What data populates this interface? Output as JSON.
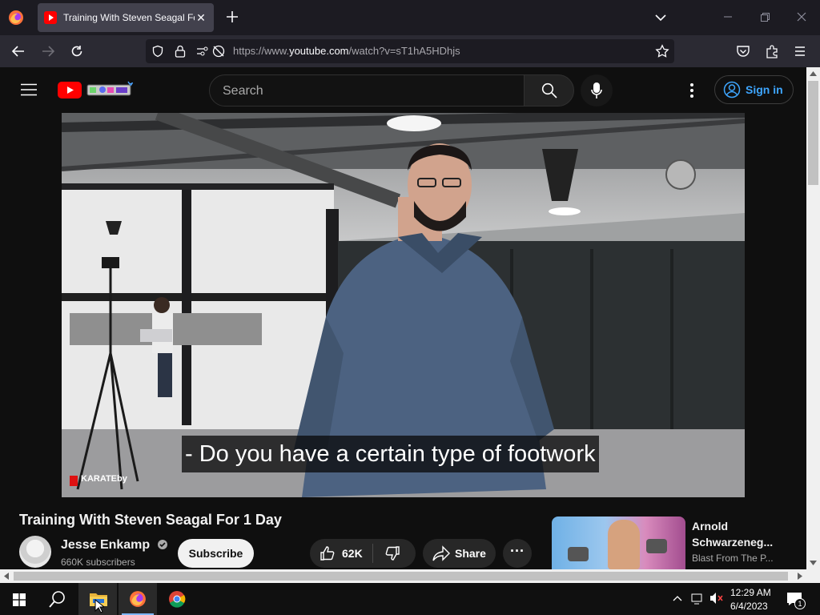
{
  "browser": {
    "tab_title": "Training With Steven Seagal For 1 Day",
    "url_prefix": "https://www.",
    "url_domain": "youtube.com",
    "url_path": "/watch?v=sT1hA5HDhjs"
  },
  "youtube": {
    "search_placeholder": "Search",
    "sign_in_label": "Sign in",
    "caption": "- Do you have a certain type of footwork",
    "watermark": "KARATEby",
    "video_title": "Training With Steven Seagal For 1 Day",
    "channel_name": "Jesse Enkamp",
    "subscribers": "660K subscribers",
    "subscribe_label": "Subscribe",
    "like_count": "62K",
    "share_label": "Share",
    "related": {
      "title": "Arnold Schwarzeneg...",
      "channel": "Blast From The P..."
    }
  },
  "taskbar": {
    "time": "12:29 AM",
    "date": "6/4/2023",
    "notification_count": "1"
  },
  "colors": {
    "accent_blue": "#3ea6ff",
    "youtube_red": "#ff0000",
    "firefox_bg": "#1c1b22"
  }
}
